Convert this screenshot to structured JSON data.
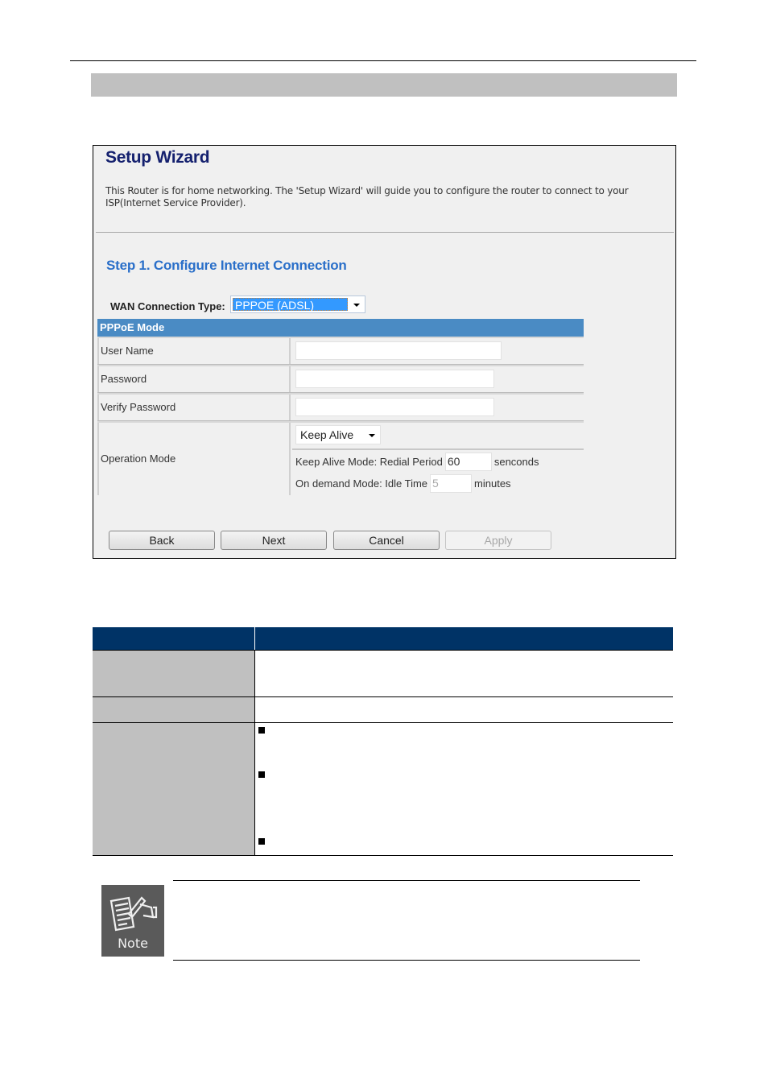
{
  "setup_wizard": {
    "title": "Setup Wizard",
    "description": "This Router is for home networking. The 'Setup Wizard' will guide you to configure the router to connect to your ISP(Internet Service Provider).",
    "step_title": "Step 1. Configure Internet Connection",
    "wan_connection_type": {
      "label": "WAN Connection Type:",
      "selected": "PPPOE (ADSL)"
    },
    "pppoe": {
      "header": "PPPoE Mode",
      "fields": [
        {
          "label": "User Name",
          "value": ""
        },
        {
          "label": "Password",
          "value": ""
        },
        {
          "label": "Verify Password",
          "value": ""
        }
      ],
      "operation_mode": {
        "label": "Operation Mode",
        "selected": "Keep Alive",
        "keep_alive_label": "Keep Alive Mode: Redial Period",
        "keep_alive_value": "60",
        "keep_alive_unit": "senconds",
        "on_demand_label": "On demand Mode: Idle Time",
        "on_demand_value": "5",
        "on_demand_unit": "minutes"
      }
    },
    "buttons": {
      "back": "Back",
      "next": "Next",
      "cancel": "Cancel",
      "apply": "Apply"
    }
  },
  "parameter_table": {
    "header_color": "#003366",
    "object_cell_color": "#c0c0c0",
    "rows": 3
  },
  "note": {
    "icon_label": "Note"
  },
  "colors": {
    "title": "#14206e",
    "step_title": "#2a6fc9",
    "pppoe_header": "#4a8bc4",
    "selected_option": "#3399ff",
    "section_bar": "#c0c0c0"
  }
}
